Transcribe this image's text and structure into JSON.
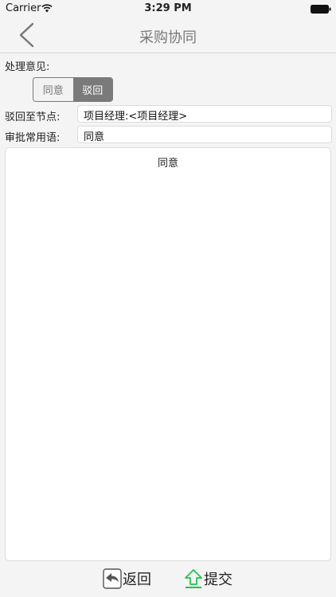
{
  "status_bar": {
    "carrier": "Carrier",
    "time": "3:29 PM",
    "icons": [
      "wifi-icon",
      "battery-icon"
    ]
  },
  "nav": {
    "title": "采购协同",
    "back_icon": "chevron-left-icon"
  },
  "form": {
    "opinion_label": "处理意见:",
    "segments": {
      "agree": "同意",
      "reject": "驳回",
      "selected": "驳回"
    },
    "node_label": "驳回至节点:",
    "node_value": "项目经理:<项目经理>",
    "phrase_label": "审批常用语:",
    "phrase_value": "同意",
    "comment_text": "同意"
  },
  "bottom_bar": {
    "return_label": "返回",
    "return_icon": "return-arrow-icon",
    "submit_label": "提交",
    "submit_icon": "upload-arrow-icon"
  },
  "colors": {
    "background": "#f4f4f4",
    "selected_segment": "#7a7a7a",
    "submit_icon": "#22c44e"
  }
}
